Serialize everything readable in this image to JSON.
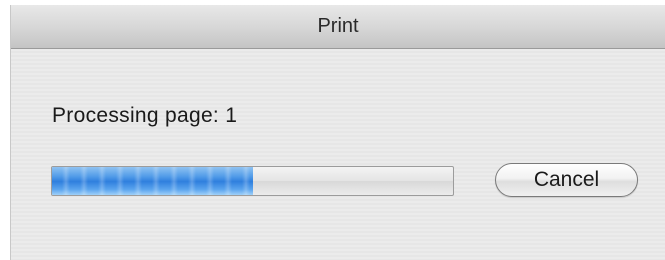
{
  "window": {
    "title": "Print"
  },
  "status": {
    "text": "Processing page: 1"
  },
  "progress": {
    "fraction": 0.5
  },
  "buttons": {
    "cancel_label": "Cancel"
  }
}
